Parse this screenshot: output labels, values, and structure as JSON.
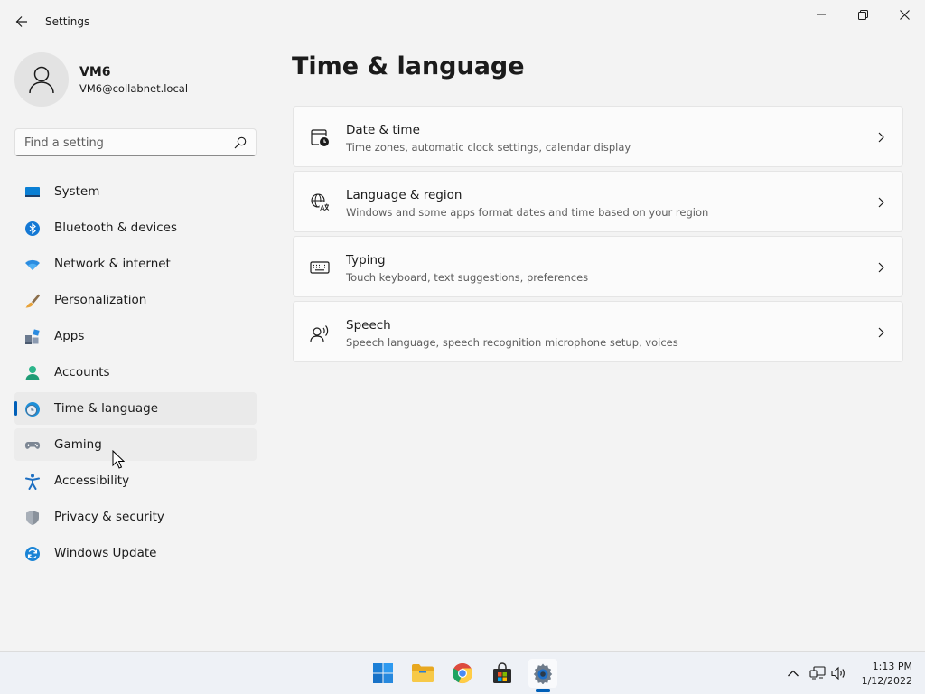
{
  "window": {
    "title": "Settings"
  },
  "profile": {
    "name": "VM6",
    "email": "VM6@collabnet.local"
  },
  "search": {
    "placeholder": "Find a setting"
  },
  "sidebar": {
    "items": [
      {
        "label": "System",
        "icon": "system-icon"
      },
      {
        "label": "Bluetooth & devices",
        "icon": "bluetooth-icon"
      },
      {
        "label": "Network & internet",
        "icon": "wifi-icon"
      },
      {
        "label": "Personalization",
        "icon": "brush-icon"
      },
      {
        "label": "Apps",
        "icon": "apps-icon"
      },
      {
        "label": "Accounts",
        "icon": "person-icon"
      },
      {
        "label": "Time & language",
        "icon": "globe-clock-icon",
        "selected": true
      },
      {
        "label": "Gaming",
        "icon": "gamepad-icon",
        "hovered": true
      },
      {
        "label": "Accessibility",
        "icon": "accessibility-icon"
      },
      {
        "label": "Privacy & security",
        "icon": "shield-icon"
      },
      {
        "label": "Windows Update",
        "icon": "update-icon"
      }
    ]
  },
  "main": {
    "title": "Time & language",
    "cards": [
      {
        "title": "Date & time",
        "subtitle": "Time zones, automatic clock settings, calendar display",
        "icon": "calendar-clock-icon"
      },
      {
        "title": "Language & region",
        "subtitle": "Windows and some apps format dates and time based on your region",
        "icon": "language-icon"
      },
      {
        "title": "Typing",
        "subtitle": "Touch keyboard, text suggestions, preferences",
        "icon": "keyboard-icon"
      },
      {
        "title": "Speech",
        "subtitle": "Speech language, speech recognition microphone setup, voices",
        "icon": "speech-icon"
      }
    ]
  },
  "taskbar": {
    "apps": [
      "windows-start-icon",
      "file-explorer-icon",
      "chrome-icon",
      "store-icon",
      "settings-gear-icon"
    ],
    "tray": [
      "chevron-up-icon",
      "network-icon",
      "volume-icon"
    ],
    "time": "1:13 PM",
    "date": "1/12/2022"
  },
  "colors": {
    "accent": "#005fb8",
    "background": "#f3f3f3",
    "card": "#fbfbfb"
  }
}
